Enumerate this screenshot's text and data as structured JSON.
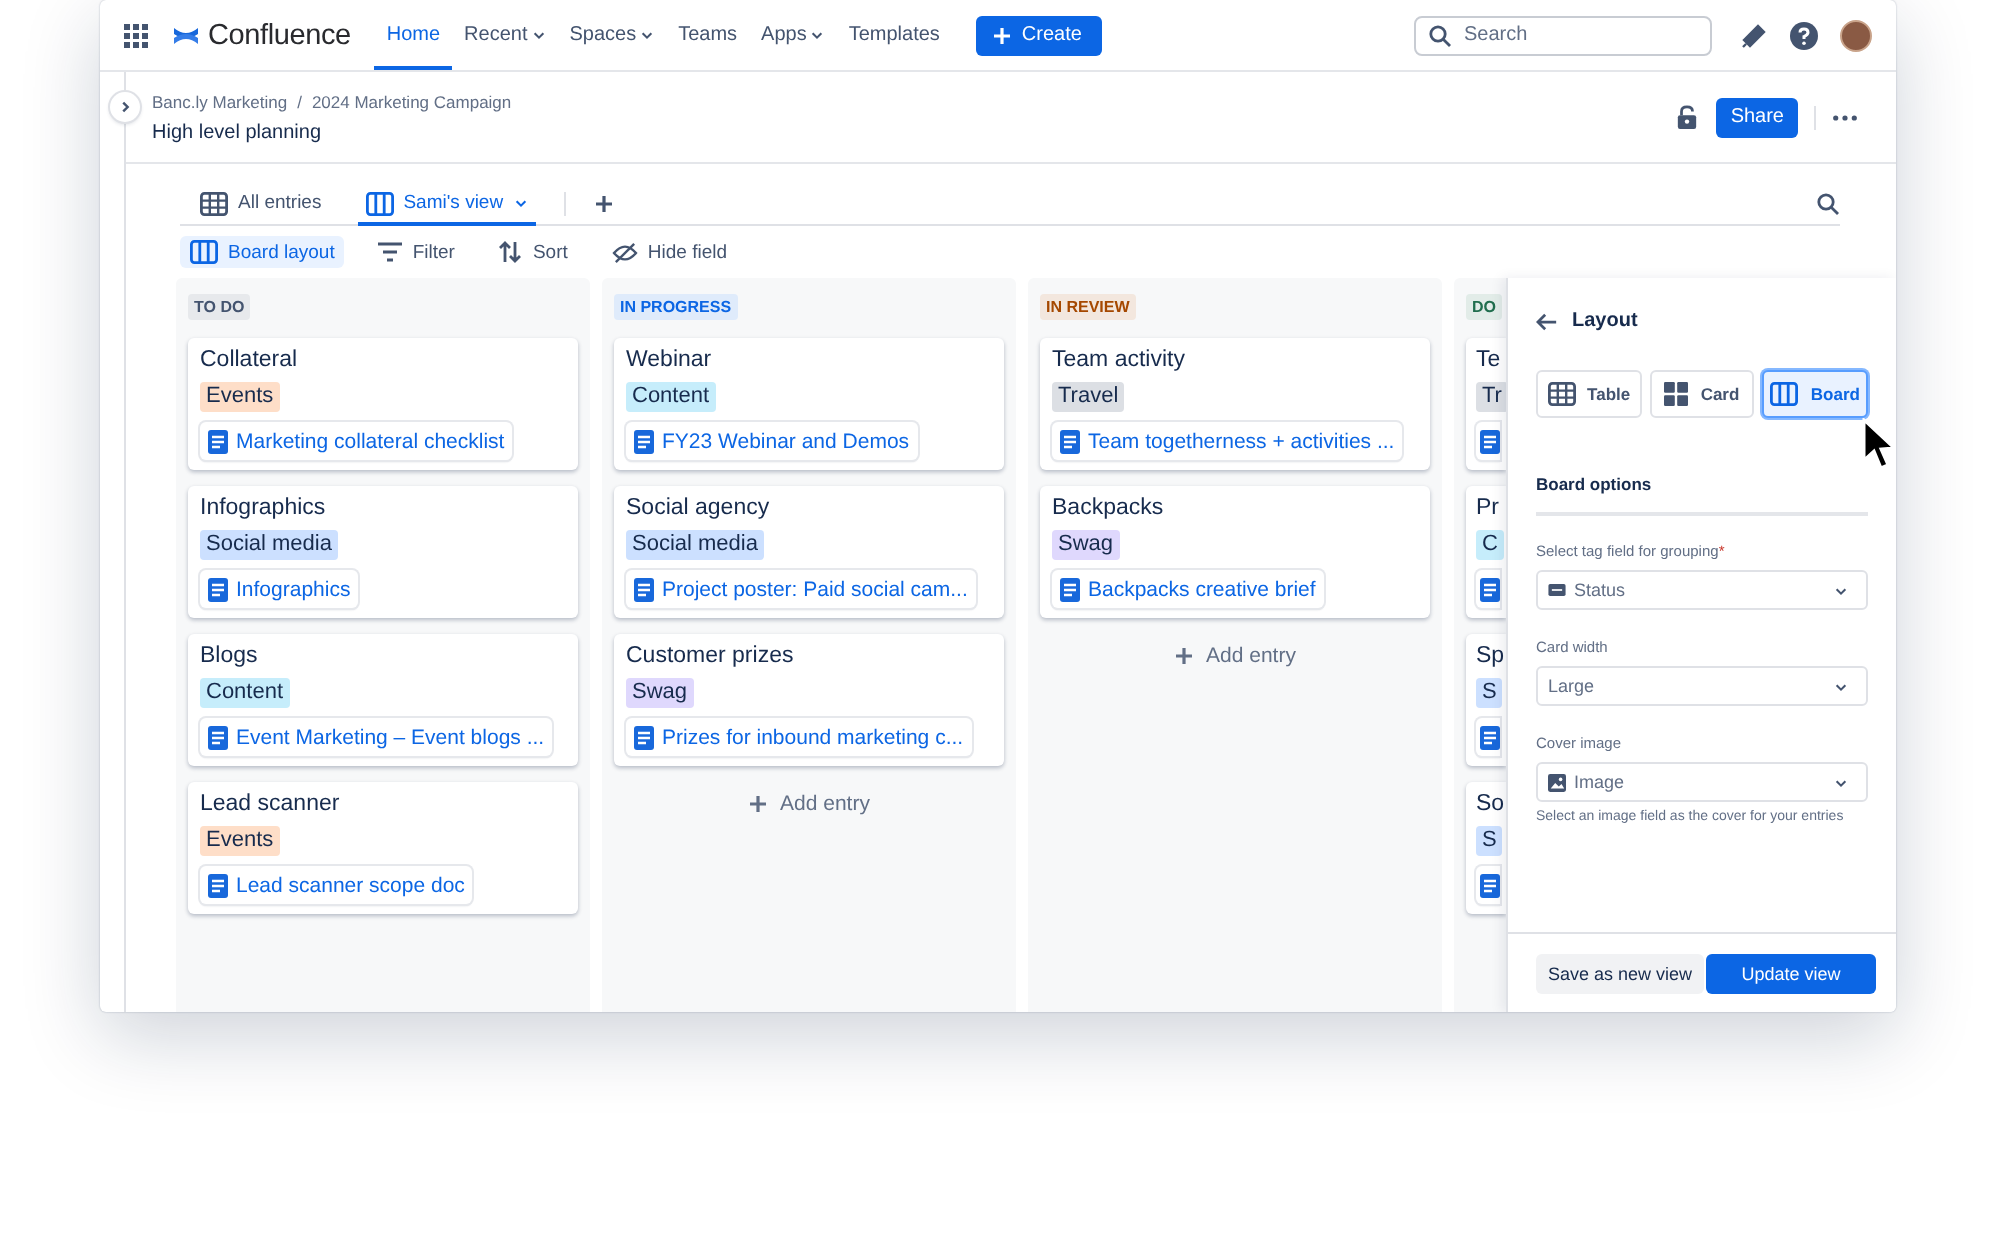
{
  "nav": {
    "app_name": "Confluence",
    "items": [
      {
        "label": "Home",
        "selected": true,
        "has_menu": false
      },
      {
        "label": "Recent",
        "selected": false,
        "has_menu": true
      },
      {
        "label": "Spaces",
        "selected": false,
        "has_menu": true
      },
      {
        "label": "Teams",
        "selected": false,
        "has_menu": false
      },
      {
        "label": "Apps",
        "selected": false,
        "has_menu": true
      },
      {
        "label": "Templates",
        "selected": false,
        "has_menu": false
      }
    ],
    "create_button": "Create",
    "search": {
      "placeholder": "Search"
    }
  },
  "page": {
    "breadcrumbs": [
      "Banc.ly Marketing",
      "2024 Marketing Campaign"
    ],
    "separator": "/",
    "title": "High level planning",
    "share_button": "Share"
  },
  "views": {
    "tabs": [
      {
        "label": "All entries",
        "kind": "table",
        "selected": false,
        "has_menu": false
      },
      {
        "label": "Sami's view",
        "kind": "board",
        "selected": true,
        "has_menu": true
      }
    ]
  },
  "toolbar": [
    {
      "label": "Board layout",
      "kind": "board",
      "selected": true
    },
    {
      "label": "Filter",
      "kind": "filter",
      "selected": false
    },
    {
      "label": "Sort",
      "kind": "sort",
      "selected": false
    },
    {
      "label": "Hide field",
      "kind": "hide",
      "selected": false
    }
  ],
  "board": {
    "columns": [
      {
        "title": "TO DO",
        "color": "#44546f",
        "cards": [
          {
            "title": "Collateral",
            "tag": {
              "label": "Events",
              "color": "#fedec8"
            },
            "has_doc": true,
            "doc": "Marketing collateral checklist"
          },
          {
            "title": "Infographics",
            "tag": {
              "label": "Social media",
              "color": "#cce0ff"
            },
            "has_doc": true,
            "doc": "Infographics"
          },
          {
            "title": "Blogs",
            "tag": {
              "label": "Content",
              "color": "#c6edfb"
            },
            "has_doc": true,
            "doc": "Event Marketing – Event blogs ..."
          },
          {
            "title": "Lead scanner",
            "tag": {
              "label": "Events",
              "color": "#fedec8"
            },
            "has_doc": true,
            "doc": "Lead scanner scope doc"
          }
        ]
      },
      {
        "title": "IN PROGRESS",
        "color": "#0c66e4",
        "add_entry": "Add entry",
        "cards": [
          {
            "title": "Webinar",
            "tag": {
              "label": "Content",
              "color": "#c6edfb"
            },
            "has_doc": true,
            "doc": "FY23 Webinar and Demos"
          },
          {
            "title": "Social agency",
            "tag": {
              "label": "Social media",
              "color": "#cce0ff"
            },
            "has_doc": true,
            "doc": "Project poster: Paid social cam..."
          },
          {
            "title": "Customer prizes",
            "tag": {
              "label": "Swag",
              "color": "#dfd8fd"
            },
            "has_doc": true,
            "doc": "Prizes for inbound marketing c..."
          }
        ]
      },
      {
        "title": "IN REVIEW",
        "color": "#a54800",
        "add_entry": "Add entry",
        "cards": [
          {
            "title": "Team activity",
            "tag": {
              "label": "Travel",
              "color": "#dcdfe4"
            },
            "has_doc": true,
            "doc": "Team togetherness + activities ..."
          },
          {
            "title": "Backpacks",
            "tag": {
              "label": "Swag",
              "color": "#dfd8fd"
            },
            "has_doc": true,
            "doc": "Backpacks creative brief"
          }
        ]
      },
      {
        "title": "DO",
        "color": "#216e4e",
        "cards": [
          {
            "title": "Te",
            "tag": {
              "label": "Tr",
              "color": "#dcdfe4"
            },
            "has_doc": true
          },
          {
            "title": "Pr",
            "tag": {
              "label": "C",
              "color": "#c6edfb"
            },
            "has_doc": true
          },
          {
            "title": "Sp",
            "tag": {
              "label": "S",
              "color": "#cce0ff"
            },
            "has_doc": true
          },
          {
            "title": "So",
            "tag": {
              "label": "S",
              "color": "#cce0ff"
            },
            "has_doc": true
          }
        ]
      }
    ]
  },
  "panel": {
    "title": "Layout",
    "layouts": [
      {
        "label": "Table",
        "kind": "table",
        "selected": false
      },
      {
        "label": "Card",
        "kind": "card",
        "selected": false
      },
      {
        "label": "Board",
        "kind": "board",
        "selected": true
      }
    ],
    "section_title": "Board options",
    "fields": [
      {
        "label": "Select tag field for grouping",
        "required_mark": "*",
        "value": "Status",
        "kind": "status"
      },
      {
        "label": "Card width",
        "value": "Large",
        "kind": "plain"
      },
      {
        "label": "Cover image",
        "value": "Image",
        "kind": "image",
        "help": "Select an image field as the cover for your entries"
      }
    ],
    "buttons": [
      {
        "label": "Save as new view",
        "kind": "secondary"
      },
      {
        "label": "Update view",
        "kind": "primary"
      }
    ]
  }
}
